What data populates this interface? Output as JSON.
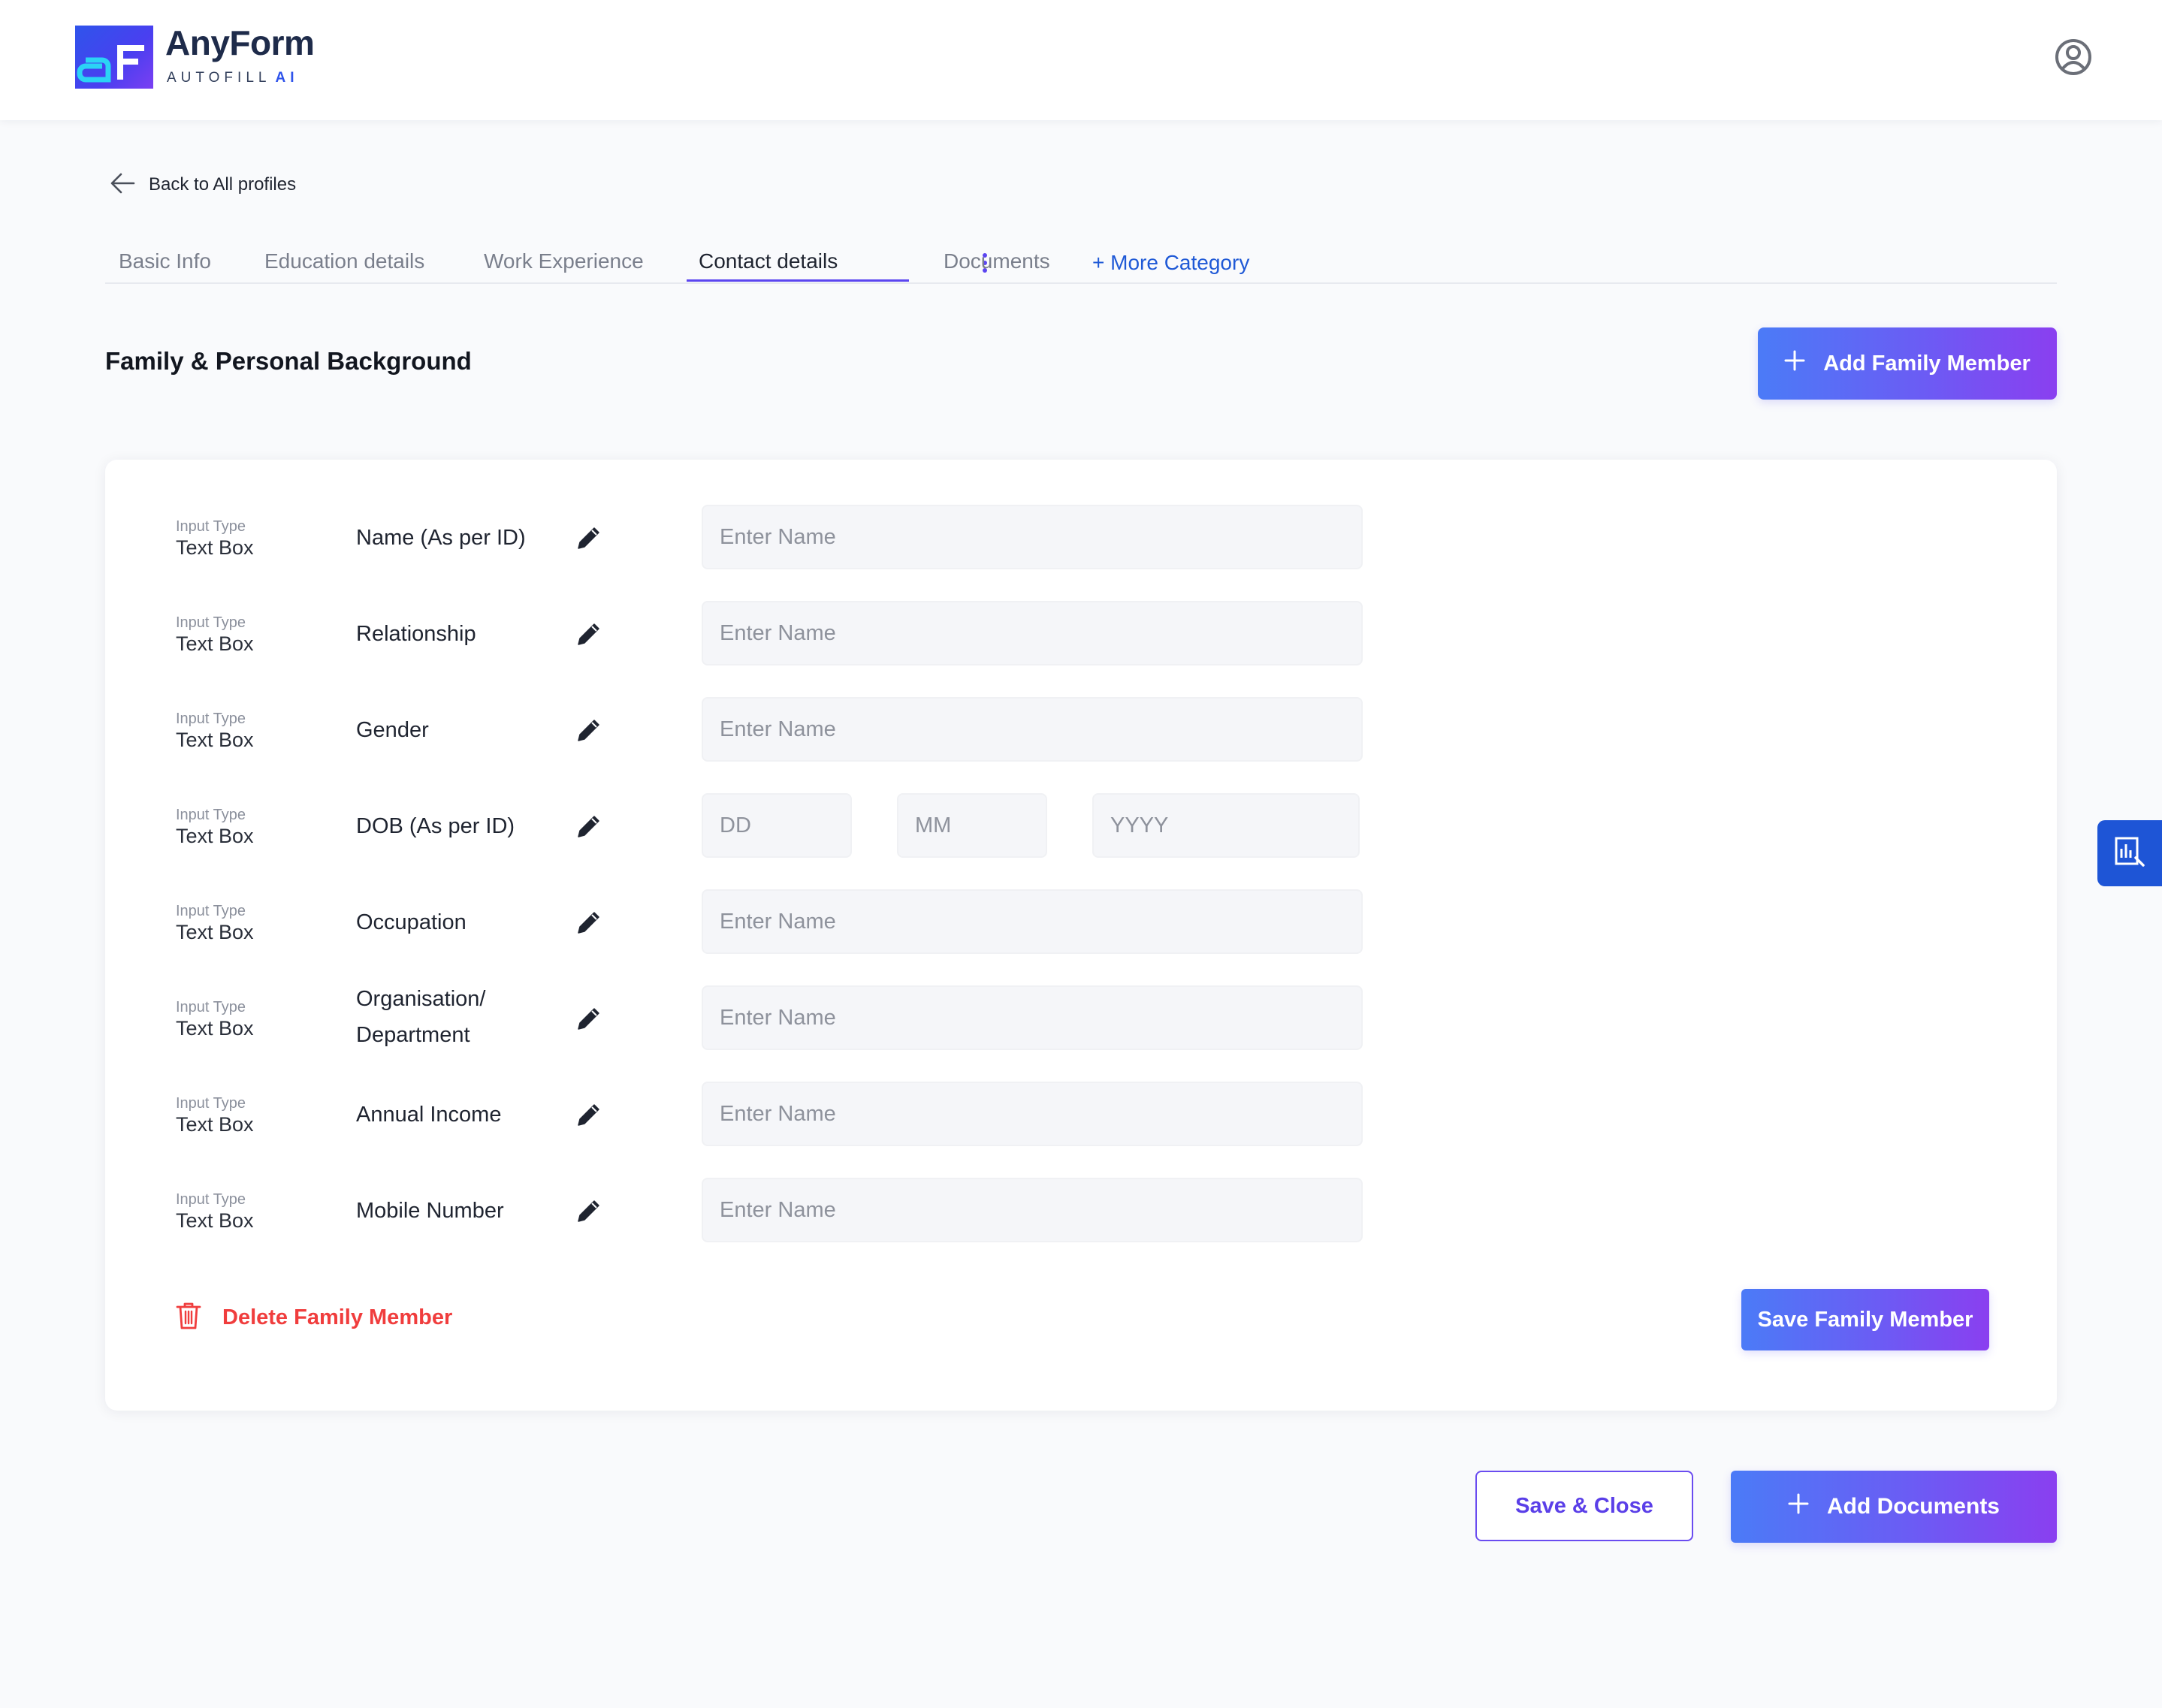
{
  "app": {
    "brand_name": "AnyForm",
    "brand_sub": "AUTOFILL",
    "brand_ai": "AI",
    "accent_color": "#5b45f0",
    "icons": {
      "profile": "user-circle-icon",
      "back": "arrow-left-icon",
      "edit": "pencil-icon",
      "delete": "trash-icon",
      "add": "plus-icon",
      "more": "kebab-menu-icon",
      "side_tab": "report-icon"
    }
  },
  "nav": {
    "back_label": "Back to All profiles"
  },
  "tabs": [
    {
      "label": "Basic Info"
    },
    {
      "label": "Education details"
    },
    {
      "label": "Work Experience"
    },
    {
      "label": "Contact details",
      "active": true
    },
    {
      "label": "Documents"
    }
  ],
  "more_category": "+ More Category",
  "section": {
    "title": "Family & Personal Background",
    "add_button": "Add Family Member"
  },
  "form": {
    "rows": [
      {
        "input_type_caption": "Input Type",
        "input_type": "Text Box",
        "label": "Name (As per ID)",
        "placeholder": "Enter Name"
      },
      {
        "input_type_caption": "Input Type",
        "input_type": "Text Box",
        "label": "Relationship",
        "placeholder": "Enter Name"
      },
      {
        "input_type_caption": "Input Type",
        "input_type": "Text Box",
        "label": "Gender",
        "placeholder": "Enter Name"
      },
      {
        "input_type_caption": "Input Type",
        "input_type": "Text Box",
        "label": "DOB (As per ID)",
        "placeholders": {
          "day": "DD",
          "month": "MM",
          "year": "YYYY"
        }
      },
      {
        "input_type_caption": "Input Type",
        "input_type": "Text Box",
        "label": "Occupation",
        "placeholder": "Enter Name"
      },
      {
        "input_type_caption": "Input Type",
        "input_type": "Text Box",
        "label_line1": "Organisation/",
        "label_line2": "Department",
        "placeholder": "Enter Name"
      },
      {
        "input_type_caption": "Input Type",
        "input_type": "Text Box",
        "label": "Annual Income",
        "placeholder": "Enter Name"
      },
      {
        "input_type_caption": "Input Type",
        "input_type": "Text Box",
        "label": "Mobile Number",
        "placeholder": "Enter Name"
      }
    ],
    "delete_label": "Delete Family Member",
    "save_label": "Save Family Member"
  },
  "footer": {
    "save_close": "Save & Close",
    "add_documents": "Add Documents"
  }
}
